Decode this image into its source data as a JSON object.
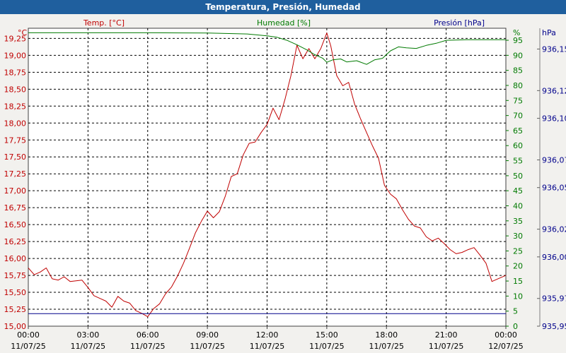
{
  "window": {
    "title": "Temperatura, Presión, Humedad"
  },
  "chart_data": {
    "type": "line",
    "x_ticks": [
      {
        "time": "00:00",
        "date": "11/07/25"
      },
      {
        "time": "03:00",
        "date": "11/07/25"
      },
      {
        "time": "06:00",
        "date": "11/07/25"
      },
      {
        "time": "09:00",
        "date": "11/07/25"
      },
      {
        "time": "12:00",
        "date": "11/07/25"
      },
      {
        "time": "15:00",
        "date": "11/07/25"
      },
      {
        "time": "18:00",
        "date": "11/07/25"
      },
      {
        "time": "21:00",
        "date": "11/07/25"
      },
      {
        "time": "00:00",
        "date": "12/07/25"
      }
    ],
    "axes": {
      "temperature": {
        "label": "Temp. [°C]",
        "unit": "°C",
        "color": "#c00000",
        "ylim": [
          15.0,
          19.4
        ],
        "ticks": [
          "15,00",
          "15,25",
          "15,50",
          "15,75",
          "16,00",
          "16,25",
          "16,50",
          "16,75",
          "17,00",
          "17,25",
          "17,50",
          "17,75",
          "18,00",
          "18,25",
          "18,50",
          "18,75",
          "19,00",
          "19,25"
        ]
      },
      "humidity": {
        "label": "Humedad [%]",
        "unit": "%",
        "color": "#007a00",
        "ylim": [
          0,
          99
        ],
        "ticks": [
          "0",
          "5",
          "10",
          "15",
          "20",
          "25",
          "30",
          "35",
          "40",
          "45",
          "50",
          "55",
          "60",
          "65",
          "70",
          "75",
          "80",
          "85",
          "90",
          "95"
        ]
      },
      "pressure": {
        "label": "Presión [hPa]",
        "unit": "hPa",
        "color": "#00008b",
        "ylim": [
          935.95,
          936.165
        ],
        "ticks": [
          "935,95",
          "935,97",
          "936,00",
          "936,02",
          "936,05",
          "936,07",
          "936,10",
          "936,12",
          "936,15"
        ]
      }
    },
    "series": [
      {
        "name": "Temp. [°C]",
        "axis": "temperature",
        "x_hours": [
          0,
          0.3,
          0.6,
          0.9,
          1.2,
          1.5,
          1.8,
          2.1,
          2.4,
          2.7,
          3.0,
          3.3,
          3.6,
          3.9,
          4.2,
          4.5,
          4.8,
          5.1,
          5.4,
          5.7,
          6.0,
          6.3,
          6.6,
          6.9,
          7.2,
          7.5,
          7.8,
          8.1,
          8.4,
          8.7,
          9.0,
          9.3,
          9.6,
          9.9,
          10.2,
          10.5,
          10.8,
          11.1,
          11.4,
          11.7,
          12.0,
          12.3,
          12.6,
          12.9,
          13.2,
          13.5,
          13.8,
          14.1,
          14.4,
          14.7,
          15.0,
          15.2,
          15.5,
          15.8,
          16.1,
          16.4,
          16.7,
          17.0,
          17.3,
          17.6,
          17.9,
          18.2,
          18.5,
          18.8,
          19.1,
          19.4,
          19.7,
          20.0,
          20.3,
          20.6,
          20.9,
          21.2,
          21.5,
          21.8,
          22.1,
          22.4,
          22.7,
          23.0,
          23.3,
          23.6,
          24.0
        ],
        "values": [
          15.86,
          15.76,
          15.8,
          15.86,
          15.7,
          15.68,
          15.73,
          15.66,
          15.67,
          15.68,
          15.57,
          15.45,
          15.41,
          15.37,
          15.28,
          15.44,
          15.37,
          15.34,
          15.23,
          15.19,
          15.14,
          15.26,
          15.33,
          15.48,
          15.58,
          15.74,
          15.93,
          16.15,
          16.38,
          16.55,
          16.7,
          16.6,
          16.69,
          16.92,
          17.21,
          17.25,
          17.53,
          17.7,
          17.72,
          17.86,
          17.98,
          18.22,
          18.05,
          18.35,
          18.7,
          19.15,
          18.95,
          19.1,
          18.95,
          19.1,
          19.33,
          19.14,
          18.7,
          18.55,
          18.6,
          18.28,
          18.06,
          17.86,
          17.66,
          17.48,
          17.08,
          16.95,
          16.88,
          16.72,
          16.58,
          16.48,
          16.45,
          16.32,
          16.26,
          16.3,
          16.22,
          16.13,
          16.07,
          16.09,
          16.13,
          16.16,
          16.05,
          15.93,
          15.66,
          15.7,
          15.75
        ]
      },
      {
        "name": "Humedad [%]",
        "axis": "humidity",
        "x_hours": [
          0,
          3,
          6,
          9,
          11,
          12,
          12.5,
          13,
          13.5,
          14,
          14.4,
          14.8,
          15,
          15.3,
          15.7,
          16,
          16.5,
          17,
          17.4,
          17.8,
          18.2,
          18.6,
          19,
          19.5,
          20,
          20.5,
          21,
          22,
          23,
          24
        ],
        "values": [
          97.5,
          97.5,
          97.5,
          97.4,
          97.1,
          96.5,
          96.0,
          95.0,
          93.5,
          91.8,
          90.2,
          89.0,
          87.7,
          88.5,
          88.8,
          87.8,
          88.2,
          87.0,
          88.5,
          89.0,
          91.5,
          92.8,
          92.5,
          92.3,
          93.3,
          94.0,
          95.0,
          95.2,
          95.2,
          95.2
        ]
      },
      {
        "name": "Presión [hPa]",
        "axis": "pressure",
        "x_hours": [
          0,
          24
        ],
        "values": [
          935.959,
          935.959
        ]
      }
    ]
  }
}
